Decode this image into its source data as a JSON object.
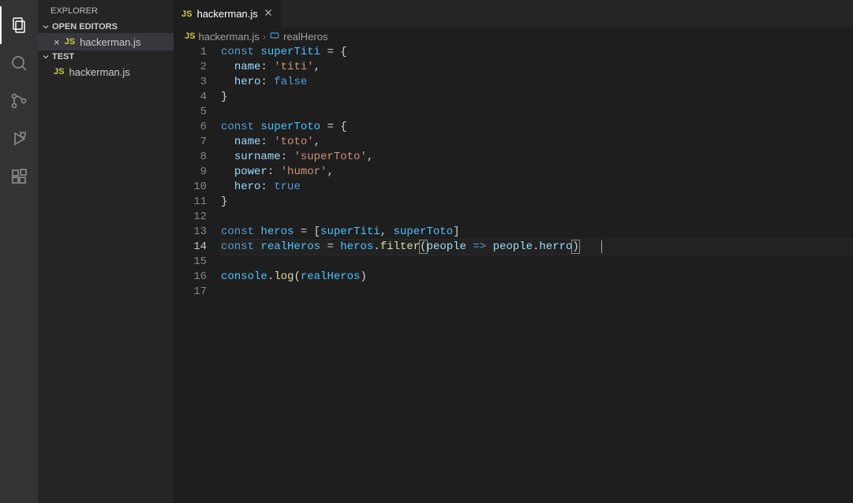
{
  "activityBar": {
    "items": [
      {
        "name": "explorer",
        "active": true
      },
      {
        "name": "search",
        "active": false
      },
      {
        "name": "source-control",
        "active": false
      },
      {
        "name": "run-debug",
        "active": false
      },
      {
        "name": "extensions",
        "active": false
      }
    ]
  },
  "sidebar": {
    "title": "EXPLORER",
    "sections": [
      {
        "label": "OPEN EDITORS",
        "items": [
          {
            "name": "hackerman.js",
            "icon": "JS",
            "selected": true
          }
        ]
      },
      {
        "label": "TEST",
        "items": [
          {
            "name": "hackerman.js",
            "icon": "JS",
            "selected": false
          }
        ]
      }
    ]
  },
  "tabs": [
    {
      "label": "hackerman.js",
      "icon": "JS",
      "active": true
    }
  ],
  "breadcrumbs": {
    "file": "hackerman.js",
    "symbol": "realHeros"
  },
  "editor": {
    "activeLine": 14,
    "lines": [
      {
        "n": 1,
        "tokens": [
          [
            "kw",
            "const"
          ],
          [
            "op",
            " "
          ],
          [
            "var",
            "superTiti"
          ],
          [
            "op",
            " = {"
          ]
        ]
      },
      {
        "n": 2,
        "tokens": [
          [
            "op",
            "  "
          ],
          [
            "prop",
            "name"
          ],
          [
            "op",
            ": "
          ],
          [
            "str",
            "'titi'"
          ],
          [
            "op",
            ","
          ]
        ]
      },
      {
        "n": 3,
        "tokens": [
          [
            "op",
            "  "
          ],
          [
            "prop",
            "hero"
          ],
          [
            "op",
            ": "
          ],
          [
            "kw",
            "false"
          ]
        ]
      },
      {
        "n": 4,
        "tokens": [
          [
            "op",
            "}"
          ]
        ]
      },
      {
        "n": 5,
        "tokens": []
      },
      {
        "n": 6,
        "tokens": [
          [
            "kw",
            "const"
          ],
          [
            "op",
            " "
          ],
          [
            "var",
            "superToto"
          ],
          [
            "op",
            " = {"
          ]
        ]
      },
      {
        "n": 7,
        "tokens": [
          [
            "op",
            "  "
          ],
          [
            "prop",
            "name"
          ],
          [
            "op",
            ": "
          ],
          [
            "str",
            "'toto'"
          ],
          [
            "op",
            ","
          ]
        ]
      },
      {
        "n": 8,
        "tokens": [
          [
            "op",
            "  "
          ],
          [
            "prop",
            "surname"
          ],
          [
            "op",
            ": "
          ],
          [
            "str",
            "'superToto'"
          ],
          [
            "op",
            ","
          ]
        ]
      },
      {
        "n": 9,
        "tokens": [
          [
            "op",
            "  "
          ],
          [
            "prop",
            "power"
          ],
          [
            "op",
            ": "
          ],
          [
            "str",
            "'humor'"
          ],
          [
            "op",
            ","
          ]
        ]
      },
      {
        "n": 10,
        "tokens": [
          [
            "op",
            "  "
          ],
          [
            "prop",
            "hero"
          ],
          [
            "op",
            ": "
          ],
          [
            "kw",
            "true"
          ]
        ]
      },
      {
        "n": 11,
        "tokens": [
          [
            "op",
            "}"
          ]
        ]
      },
      {
        "n": 12,
        "tokens": []
      },
      {
        "n": 13,
        "tokens": [
          [
            "kw",
            "const"
          ],
          [
            "op",
            " "
          ],
          [
            "var",
            "heros"
          ],
          [
            "op",
            " = ["
          ],
          [
            "var",
            "superTiti"
          ],
          [
            "op",
            ", "
          ],
          [
            "var",
            "superToto"
          ],
          [
            "op",
            "]"
          ]
        ]
      },
      {
        "n": 14,
        "tokens": [
          [
            "kw",
            "const"
          ],
          [
            "op",
            " "
          ],
          [
            "var",
            "realHeros"
          ],
          [
            "op",
            " = "
          ],
          [
            "var",
            "heros"
          ],
          [
            "op",
            "."
          ],
          [
            "fn",
            "filter"
          ],
          [
            "bm",
            "("
          ],
          [
            "arg",
            "people"
          ],
          [
            "op",
            " "
          ],
          [
            "kw",
            "=>"
          ],
          [
            "op",
            " "
          ],
          [
            "arg",
            "people"
          ],
          [
            "op",
            "."
          ],
          [
            "prop",
            "herro"
          ],
          [
            "bm",
            ")"
          ]
        ]
      },
      {
        "n": 15,
        "tokens": []
      },
      {
        "n": 16,
        "tokens": [
          [
            "var",
            "console"
          ],
          [
            "op",
            "."
          ],
          [
            "fn",
            "log"
          ],
          [
            "op",
            "("
          ],
          [
            "var",
            "realHeros"
          ],
          [
            "op",
            ")"
          ]
        ]
      },
      {
        "n": 17,
        "tokens": []
      }
    ]
  }
}
